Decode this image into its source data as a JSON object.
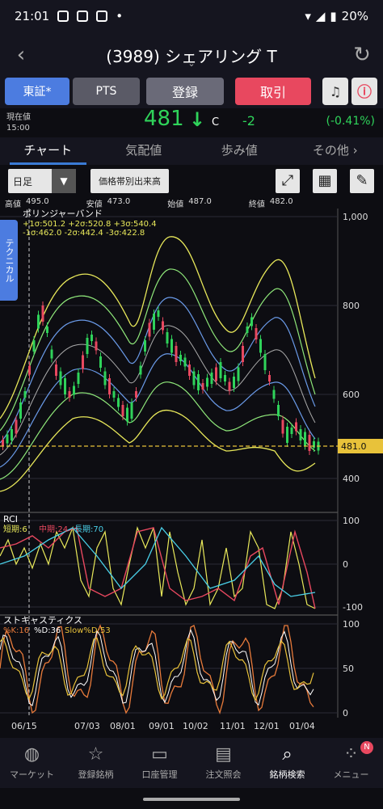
{
  "status_bar": {
    "time": "21:01",
    "battery": "20%"
  },
  "header": {
    "title": "(3989) シェアリング T"
  },
  "actions": {
    "market": "東証*",
    "pts": "PTS",
    "register": "登録",
    "trade": "取引"
  },
  "quote": {
    "label": "現在値",
    "time": "15:00",
    "price": "481",
    "flag": "C",
    "change": "-2",
    "change_pct": "(-0.41%)"
  },
  "tabs": [
    {
      "label": "チャート"
    },
    {
      "label": "気配値"
    },
    {
      "label": "歩み値"
    },
    {
      "label": "その他"
    }
  ],
  "toolbar": {
    "period": "日足",
    "volume_btn": "価格帯別出来高"
  },
  "ohlc": {
    "high_label": "高値",
    "high": "495.0",
    "low_label": "安値",
    "low": "473.0",
    "open_label": "始値",
    "open": "487.0",
    "close_label": "終値",
    "close": "482.0"
  },
  "side_tab": "テクニカル",
  "chart": {
    "bb_title": "ボリンジャーバンド",
    "bb_legend1": "+1σ:501.2 +2σ:520.8 +3σ:540.4",
    "bb_legend2": "-1σ:462.0 -2σ:442.4 -3σ:422.8",
    "price_ticks": [
      "1,000",
      "800",
      "600",
      "400"
    ],
    "current_price_tag": "481.0",
    "rci_title": "RCI",
    "rci_legend": [
      "短期:6",
      "中期:24",
      "長期:70"
    ],
    "rci_ticks": [
      "100",
      "0",
      "-100"
    ],
    "stoch_title": "ストキャスティクス",
    "stoch_legend": [
      "%K:16",
      "%D:36",
      "Slow%D:53"
    ],
    "stoch_ticks": [
      "100",
      "50",
      "0"
    ],
    "x_labels": [
      "06/15",
      "07/03",
      "08/01",
      "09/01",
      "10/02",
      "11/01",
      "12/01",
      "01/04"
    ]
  },
  "colors": {
    "accent": "#4c7ce0",
    "down": "#2fd35a",
    "trade": "#e8485f"
  },
  "bottom_nav": [
    {
      "label": "マーケット",
      "icon": "globe-icon"
    },
    {
      "label": "登録銘柄",
      "icon": "star-icon"
    },
    {
      "label": "口座管理",
      "icon": "card-icon"
    },
    {
      "label": "注文照会",
      "icon": "document-icon"
    },
    {
      "label": "銘柄検索",
      "icon": "search-icon"
    },
    {
      "label": "メニュー",
      "icon": "menu-grid-icon"
    }
  ],
  "badge": "N"
}
